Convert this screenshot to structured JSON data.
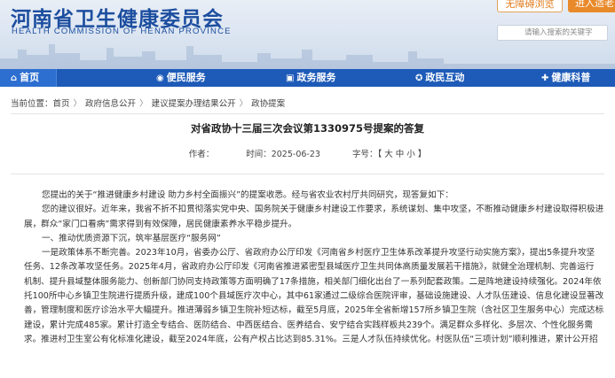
{
  "site": {
    "name_cn": "河南省卫生健康委员会",
    "name_en": "HEALTH COMMISSION OF HENAN PROVINCE",
    "barrier_free": "无障碍浏览",
    "login": "进入适老",
    "search_placeholder": "请输入搜索的关键字"
  },
  "nav": [
    {
      "label": "首页",
      "icon": "home-icon"
    },
    {
      "label": "便民服务",
      "icon": "service-icon"
    },
    {
      "label": "政务服务",
      "icon": "government-icon"
    },
    {
      "label": "政民互动",
      "icon": "interaction-icon"
    },
    {
      "label": "健康科普",
      "icon": "health-icon"
    }
  ],
  "breadcrumb": {
    "prefix": "当前位置：",
    "items": [
      "首页",
      "政府信息公开",
      "建议提案办理结果公开",
      "政协提案"
    ]
  },
  "article": {
    "title": "对省政协十三届三次会议第1330975号提案的答复",
    "author_label": "作者：",
    "time_label": "时间：",
    "time": "2025-06-23",
    "fontsize_label": "字号：",
    "fontsize_options": "【 大 中 小 】",
    "paragraphs": [
      "您提出的关于“推进健康乡村建设 助力乡村全面振兴”的提案收悉。经与省农业农村厅共同研究，现答复如下：",
      "您的建议很好。近年来，我省不折不扣贯彻落实党中央、国务院关于健康乡村建设工作要求，系统谋划、集中攻坚，不断推动健康乡村建设取得积极进",
      "展，群众“家门口看病”需求得到有效保障，居民健康素养水平稳步提升。",
      "一、推动优质资源下沉，筑牢基层医疗“服务网”",
      "一是政策体系不断完善。2023年10月，省委办公厅、省政府办公厅印发《河南省乡村医疗卫生体系改革提升攻坚行动实施方案》，提出5条提升攻坚",
      "任务、12条改革攻坚任务。2025年4月，省政府办公厅印发《河南省推进紧密型县域医疗卫生共同体高质量发展若干措施》，就健全治理机制、完善运行",
      "机制、提升县域整体服务能力、创新部门协同支持政策等方面明确了17条措施，相关部门细化出台了一系列配套政策。二是阵地建设持续强化。2024年依",
      "托100所中心乡镇卫生院进行提质升级，建成100个县域医疗次中心，其中61家通过二级综合医院评审，基础设施建设、人才队伍建设、信息化建设显著改",
      "善，管理制度和医疗诊治水平大幅提升。推进薄弱乡镇卫生院补短达标，截至5月底，2025年全省新增157所乡镇卫生院（含社区卫生服务中心）完成达标",
      "建设，累计完成485家。累计打造全专结合、医防结合、中西医结合、医养结合、安宁结合实践样板共239个。满足群众多样化、多层次、个性化服务需",
      "求。推进村卫生室公有化标准化建设，截至2024年底，公有产权占比达到85.31%。三是人才队伍持续优化。村医队伍“三项计划”顺利推进，累计公开招"
    ]
  }
}
